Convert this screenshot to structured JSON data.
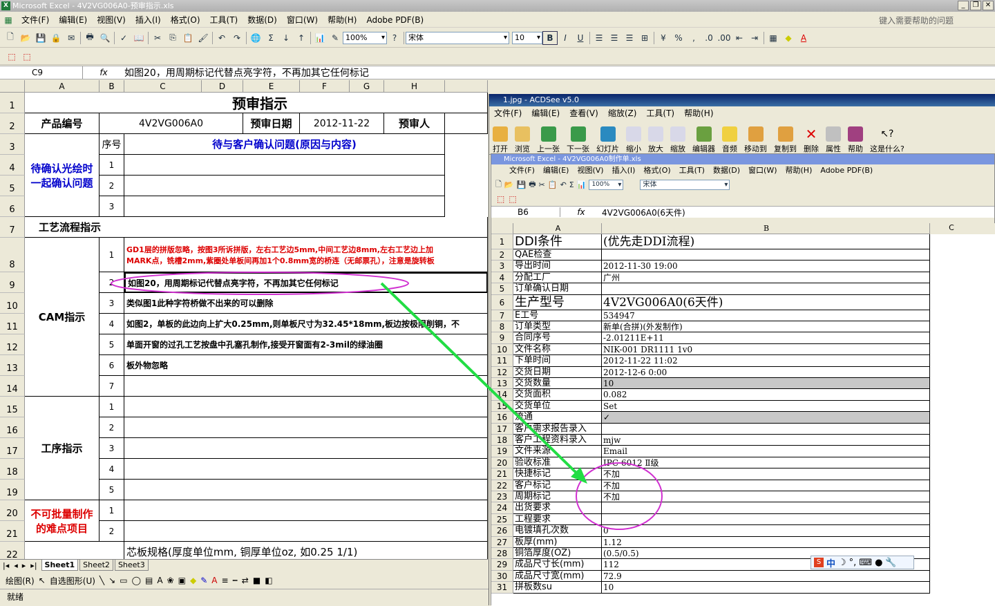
{
  "window": {
    "title": "Microsoft Excel - 4V2VG006A0-预审指示.xls"
  },
  "menu": [
    "文件(F)",
    "编辑(E)",
    "视图(V)",
    "插入(I)",
    "格式(O)",
    "工具(T)",
    "数据(D)",
    "窗口(W)",
    "帮助(H)",
    "Adobe PDF(B)"
  ],
  "help_placeholder": "键入需要帮助的问题",
  "toolbar": {
    "zoom": "100%",
    "font": "宋体",
    "size": "10"
  },
  "formula": {
    "cell": "C9",
    "fx": "fx",
    "text": "如图20，用周期标记代替点亮字符，不再加其它任何标记"
  },
  "columns": [
    "A",
    "B",
    "C",
    "D",
    "E",
    "F",
    "G",
    "H"
  ],
  "sheet": {
    "title": "预审指示",
    "product_label": "产品编号",
    "product_value": "4V2VG006A0",
    "date_label": "预审日期",
    "date_value": "2012-11-22",
    "reviewer_label": "预审人",
    "seq_label": "序号",
    "confirm_header": "待与客户确认问题(原因与内容)",
    "confirm_label": "待确认光绘时一起确认问题",
    "process_label": "工艺流程指示",
    "cam_label": "CAM指示",
    "procedure_label": "工序指示",
    "difficult_label": "不可批量制作的难点项目",
    "cam_items": [
      "GD1层的拼版忽略，按图3所诉拼版，左右工艺边5mm,中间工艺边8mm,左右工艺边上加",
      "如图20，用周期标记代替点亮字符，不再加其它任何标记",
      "类似图1此种字符桥做不出来的可以删除",
      "如图2，单板的此边向上扩大0.25mm,则单板尺寸为32.45*18mm,板边按极限削铜，不",
      "单面开窗的过孔工艺按盘中孔塞孔制作,接受开窗面有2-3mil的绿油圈",
      "板外物忽略"
    ],
    "cam_item1_line2": "MARK点，铣槽2mm,紫圈处单板间再加1个0.8mm宽的桥连（无邮票孔），注意是旋转板",
    "core_spec": "芯板规格(厚度单位mm, 铜厚单位oz, 如0.25 1/1)"
  },
  "tabs": [
    "Sheet1",
    "Sheet2",
    "Sheet3"
  ],
  "draw_label": "绘图(R)",
  "autoshape_label": "自选图形(U)",
  "status": "就绪",
  "acdsee": {
    "title": "1.jpg - ACDSee v5.0",
    "menu": [
      "文件(F)",
      "编辑(E)",
      "查看(V)",
      "缩放(Z)",
      "工具(T)",
      "帮助(H)"
    ],
    "tools": [
      "打开",
      "浏览",
      "上一张",
      "下一张",
      "幻灯片",
      "缩小",
      "放大",
      "缩放",
      "编辑器",
      "音频",
      "移动到",
      "复制到",
      "删除",
      "属性",
      "帮助",
      "这是什么?"
    ]
  },
  "inner": {
    "title": "Microsoft Excel - 4V2VG006A0制作单.xls",
    "menu": [
      "文件(F)",
      "编辑(E)",
      "视图(V)",
      "插入(I)",
      "格式(O)",
      "工具(T)",
      "数据(D)",
      "窗口(W)",
      "帮助(H)",
      "Adobe PDF(B)"
    ],
    "cell": "B6",
    "formula": "4V2VG006A0(6天件)",
    "columns": [
      "A",
      "B",
      "C"
    ],
    "rows": [
      [
        "1",
        "DDI条件",
        "(优先走DDI流程)"
      ],
      [
        "2",
        "QAE检查",
        ""
      ],
      [
        "3",
        "导出时间",
        "2012-11-30 19:00"
      ],
      [
        "4",
        "分配工厂",
        "广州"
      ],
      [
        "5",
        "订单确认日期",
        ""
      ],
      [
        "6",
        "生产型号",
        "4V2VG006A0(6天件)"
      ],
      [
        "7",
        "E工号",
        "534947"
      ],
      [
        "8",
        "订单类型",
        "新单(合拼)(外发制作)"
      ],
      [
        "9",
        "合同序号",
        "-2.01211E+11"
      ],
      [
        "10",
        "文件名称",
        "NIK-001 DR1111 1v0"
      ],
      [
        "11",
        "下单时间",
        "2012-11-22 11:02"
      ],
      [
        "12",
        "交货日期",
        "2012-12-6 0:00"
      ],
      [
        "13",
        "交货数量",
        "10"
      ],
      [
        "14",
        "交货面积",
        "0.082"
      ],
      [
        "15",
        "交货单位",
        "Set"
      ],
      [
        "16",
        "流通",
        "✓"
      ],
      [
        "17",
        "客户需求报告录入",
        ""
      ],
      [
        "18",
        "客户工程资料录入",
        "mjw"
      ],
      [
        "19",
        "文件来源",
        "Email"
      ],
      [
        "20",
        "验收标准",
        "IPC-6012 Ⅱ级"
      ],
      [
        "21",
        "快捷标记",
        "不加"
      ],
      [
        "22",
        "客户标记",
        "不加"
      ],
      [
        "23",
        "周期标记",
        "不加"
      ],
      [
        "24",
        "出货要求",
        ""
      ],
      [
        "25",
        "工程要求",
        ""
      ],
      [
        "26",
        "电镀填孔次数",
        "0"
      ],
      [
        "27",
        "板厚(mm)",
        "1.12"
      ],
      [
        "28",
        "铜箔厚度(OZ)",
        "(0.5/0.5)"
      ],
      [
        "29",
        "成品尺寸长(mm)",
        "112"
      ],
      [
        "30",
        "成品尺寸宽(mm)",
        "72.9"
      ],
      [
        "31",
        "拼板数su",
        "10"
      ]
    ]
  },
  "ime": "中"
}
